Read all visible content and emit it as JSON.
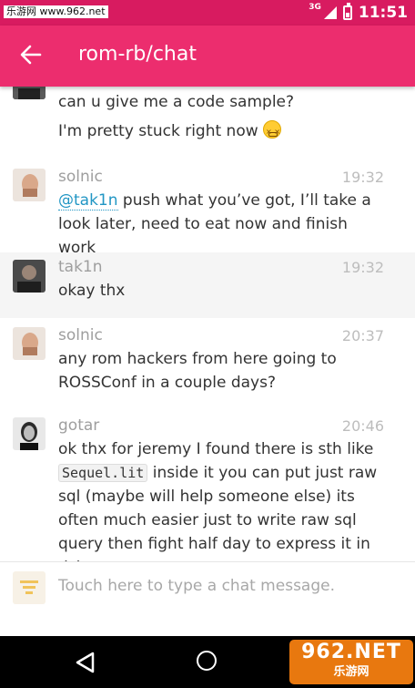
{
  "status_bar": {
    "watermark": "乐游网 www.962.net",
    "network": "3G",
    "time": "11:51"
  },
  "app_bar": {
    "title": "rom-rb/chat",
    "back_icon": "arrow-back-icon",
    "background": "#ec2d6e"
  },
  "messages": [
    {
      "username": "",
      "time": "",
      "lines": [
        "can u give me a code sample?",
        "I'm pretty stuck right now"
      ],
      "emoji": "persevering-face-emoji"
    },
    {
      "username": "solnic",
      "time": "19:32",
      "mention": "@tak1n",
      "text": " push what you’ve got, I’ll take a look later, need to eat now and finish work"
    },
    {
      "username": "tak1n",
      "time": "19:32",
      "text": "okay thx"
    },
    {
      "username": "solnic",
      "time": "20:37",
      "text": "any rom hackers from here going to ROSSConf in a couple days?"
    },
    {
      "username": "gotar",
      "time": "20:46",
      "text_before": "ok thx for jeremy I found there is sth like ",
      "code": "Sequel.lit",
      "text_after": " inside it you can put just raw sql (maybe will help someone else) its often much easier just to write raw sql query then fight half day to express it in dsl"
    }
  ],
  "input": {
    "placeholder": "Touch here to type a chat message."
  },
  "nav_bar": {
    "watermark_main": "962.NET",
    "watermark_sub": "乐游网"
  }
}
